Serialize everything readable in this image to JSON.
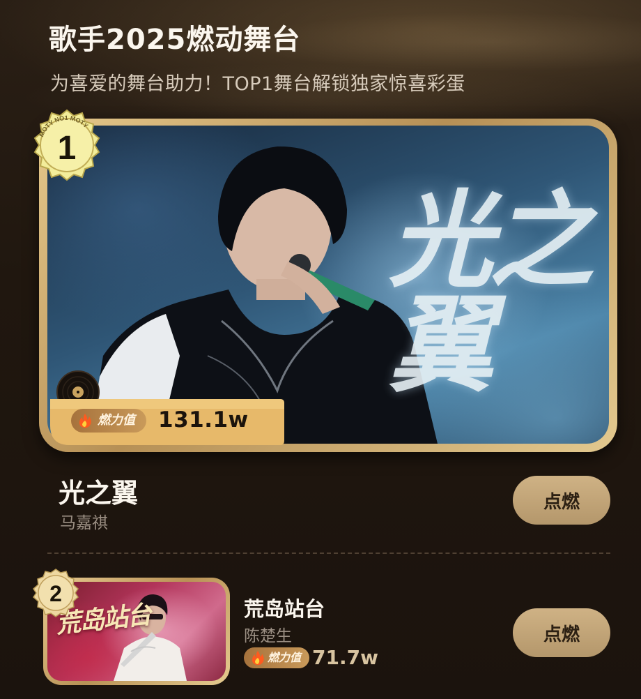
{
  "header": {
    "title": "歌手2025燃动舞台",
    "subtitle": "为喜爱的舞台助力！TOP1舞台解锁独家惊喜彩蛋"
  },
  "heat_label": "燃力值",
  "ignite_label": "点燃",
  "badge_ring_text": "MOTY NO1 MOTY",
  "ranking": [
    {
      "rank": "1",
      "song": "光之翼",
      "artist": "马嘉祺",
      "heat": "131.1w",
      "cover_text": "光之翼"
    },
    {
      "rank": "2",
      "song": "荒岛站台",
      "artist": "陈楚生",
      "heat": "71.7w",
      "cover_text": "荒岛站台"
    }
  ],
  "colors": {
    "background": "#1c140e",
    "gold": "#c9a86b",
    "button": "#c2a578",
    "text_primary": "#fbf6ee",
    "text_secondary": "#9c9084"
  },
  "icons": {
    "rank_badge": "medal-badge-icon",
    "vinyl": "vinyl-record-icon",
    "flame": "flame-icon"
  }
}
